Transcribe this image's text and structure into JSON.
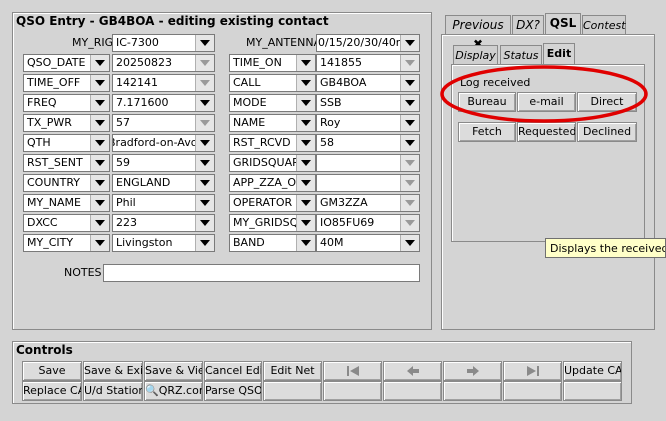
{
  "qso": {
    "title": "QSO Entry - GB4BOA - editing existing contact",
    "my_rig": {
      "label": "MY_RIG",
      "value": "IC-7300"
    },
    "my_antenna": {
      "label": "MY_ANTENNA",
      "value": "0/15/20/30/40m"
    },
    "rows_left": [
      {
        "name": "QSO_DATE",
        "value": "20250823"
      },
      {
        "name": "TIME_OFF",
        "value": "142141"
      },
      {
        "name": "FREQ",
        "value": "7.171600"
      },
      {
        "name": "TX_PWR",
        "value": "57"
      },
      {
        "name": "QTH",
        "value": "Bradford-on-Avon"
      },
      {
        "name": "RST_SENT",
        "value": "59"
      },
      {
        "name": "COUNTRY",
        "value": "ENGLAND"
      },
      {
        "name": "MY_NAME",
        "value": "Phil"
      },
      {
        "name": "DXCC",
        "value": "223"
      },
      {
        "name": "MY_CITY",
        "value": "Livingston"
      }
    ],
    "rows_right": [
      {
        "name": "TIME_ON",
        "value": "141855"
      },
      {
        "name": "CALL",
        "value": "GB4BOA"
      },
      {
        "name": "MODE",
        "value": "SSB"
      },
      {
        "name": "NAME",
        "value": "Roy"
      },
      {
        "name": "RST_RCVD",
        "value": "58"
      },
      {
        "name": "GRIDSQUARE",
        "value": ""
      },
      {
        "name": "APP_ZZA_OP",
        "value": ""
      },
      {
        "name": "OPERATOR",
        "value": "GM3ZZA"
      },
      {
        "name": "MY_GRIDSQUARE",
        "value": "IO85FU69"
      },
      {
        "name": "BAND",
        "value": "40M"
      }
    ],
    "notes_label": "NOTES",
    "notes_value": ""
  },
  "right_tabs": [
    "Previous",
    "DX?",
    "QSL",
    "Contest"
  ],
  "qsl_tabs": [
    "Display",
    "Status",
    "Edit"
  ],
  "qsl": {
    "log_received_label": "Log received",
    "buttons_row1": [
      "Bureau",
      "e-mail",
      "Direct"
    ],
    "buttons_row2": [
      "Fetch",
      "Requested",
      "Declined"
    ],
    "tooltip": "Displays the received and"
  },
  "controls": {
    "title": "Controls",
    "row1": [
      "Save",
      "Save & Exit",
      "Save & View",
      "Cancel Edit",
      "Edit Net",
      "",
      "",
      "",
      "",
      "Update CAT"
    ],
    "row2": [
      "Replace CAT",
      "U/d Station",
      "QRZ.com",
      "Parse QSO"
    ]
  },
  "colors": {
    "window_bg": "#d4d4d4",
    "field_bg": "#ffffff",
    "highlight_ellipse": "#e00000",
    "tooltip_bg": "#ffffc8"
  }
}
